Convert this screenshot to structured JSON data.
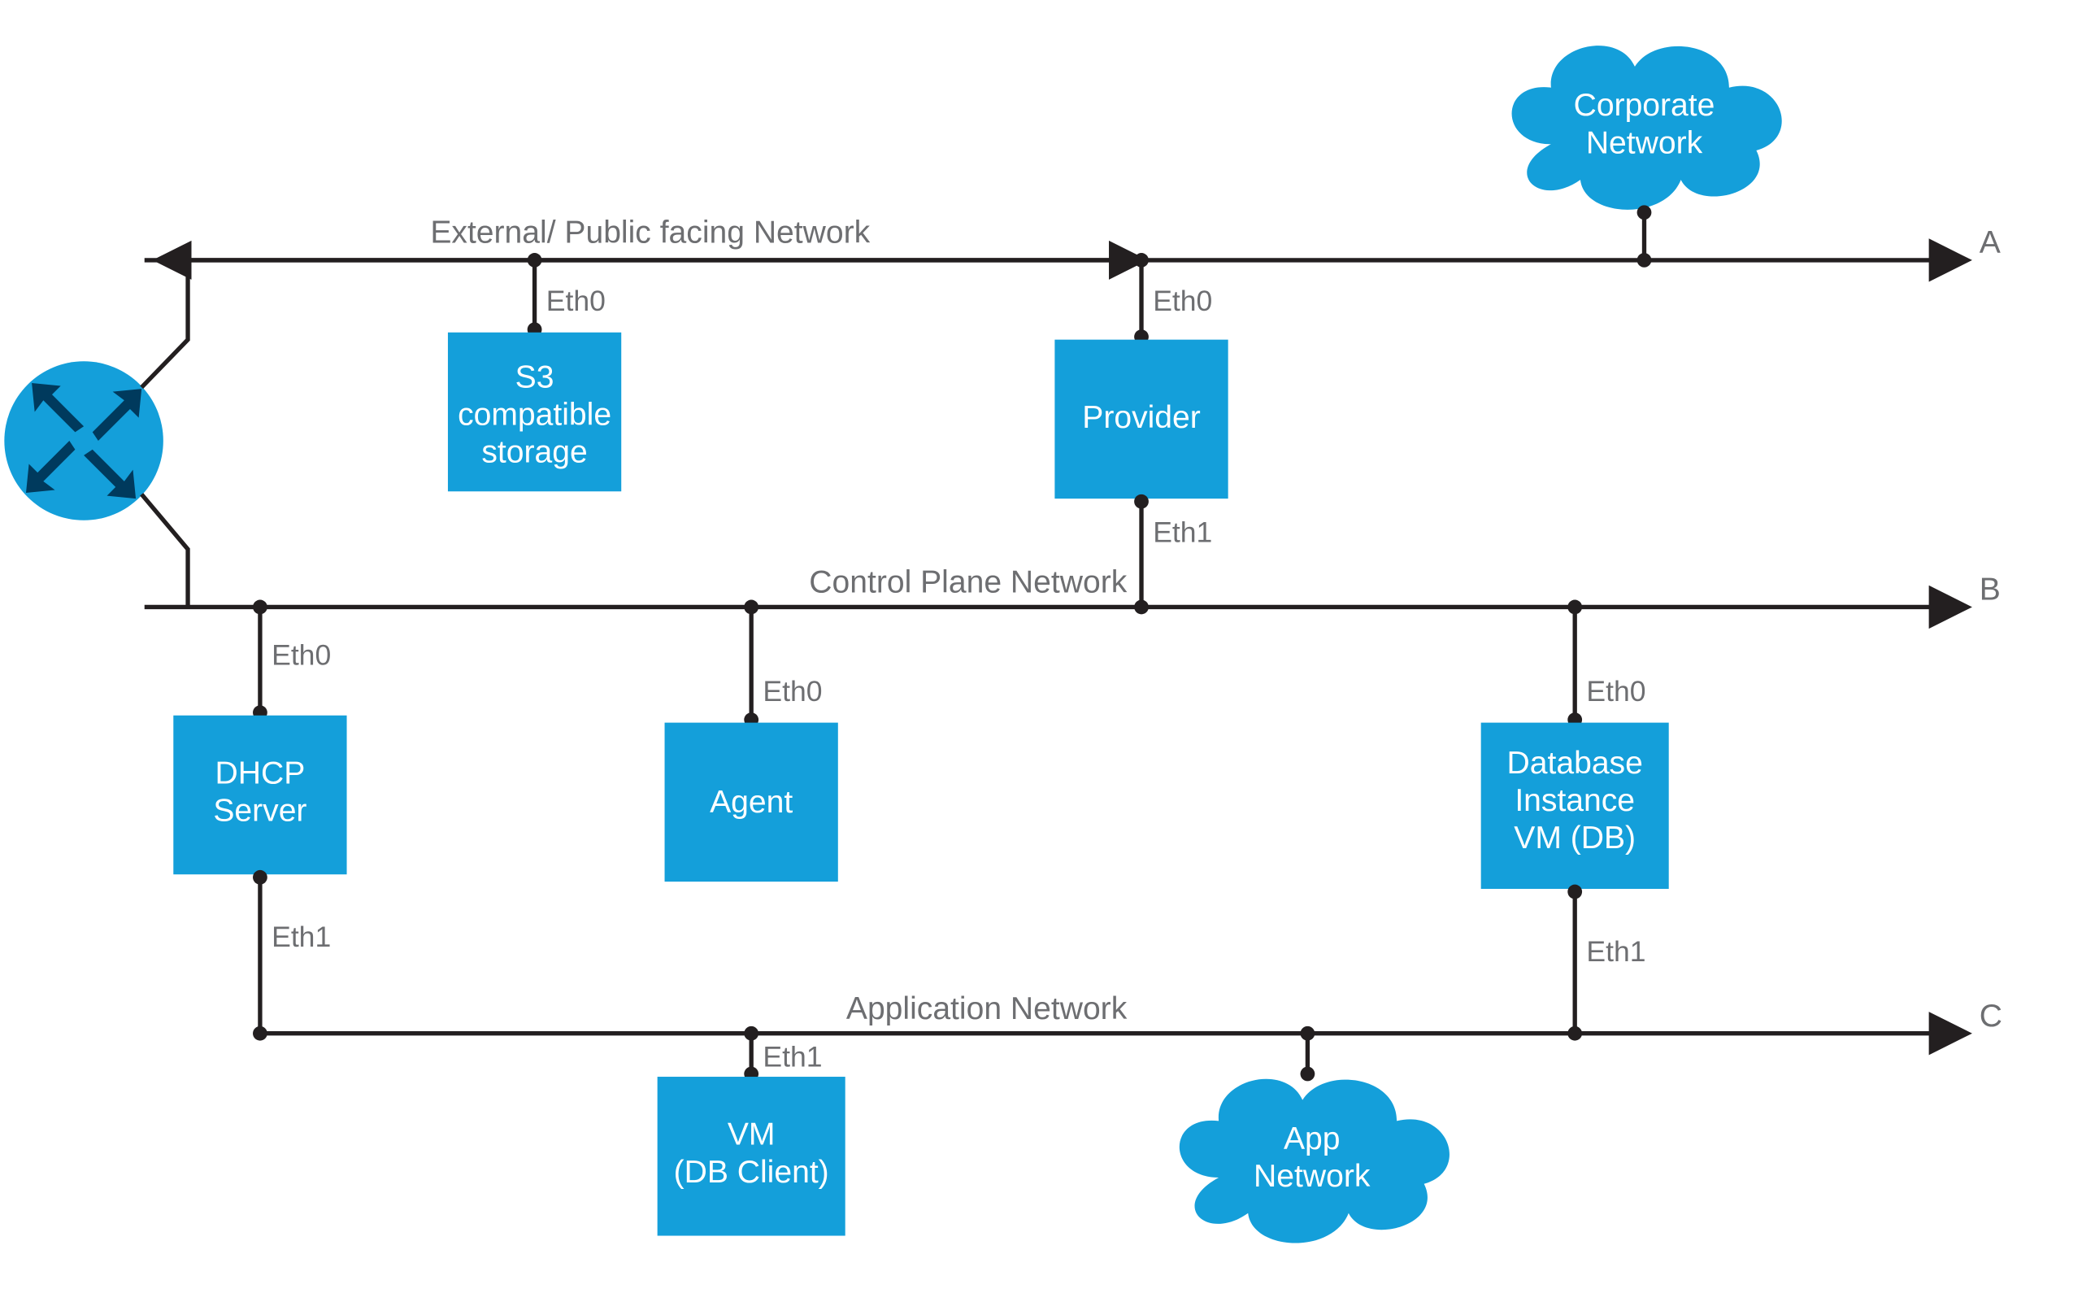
{
  "colors": {
    "blue": "#149fda",
    "dark": "#003a5d",
    "line": "#231f20",
    "text": "#6d6e71"
  },
  "buses": {
    "A": {
      "label": "External/ Public facing Network",
      "end": "A"
    },
    "B": {
      "label": "Control Plane Network",
      "end": "B"
    },
    "C": {
      "label": "Application Network",
      "end": "C"
    }
  },
  "nodes": {
    "router": {
      "icon": "router-icon"
    },
    "s3": {
      "line1": "S3",
      "line2": "compatible",
      "line3": "storage",
      "ethTop": "Eth0"
    },
    "provider": {
      "line1": "Provider",
      "ethTop": "Eth0",
      "ethBottom": "Eth1"
    },
    "dhcp": {
      "line1": "DHCP",
      "line2": "Server",
      "ethTop": "Eth0",
      "ethBottom": "Eth1"
    },
    "agent": {
      "line1": "Agent",
      "ethTop": "Eth0"
    },
    "db": {
      "line1": "Database",
      "line2": "Instance",
      "line3": "VM (DB)",
      "ethTop": "Eth0",
      "ethBottom": "Eth1"
    },
    "vmclient": {
      "line1": "VM",
      "line2": "(DB Client)",
      "ethTop": "Eth1"
    },
    "corp": {
      "line1": "Corporate",
      "line2": "Network"
    },
    "app": {
      "line1": "App",
      "line2": "Network"
    }
  }
}
